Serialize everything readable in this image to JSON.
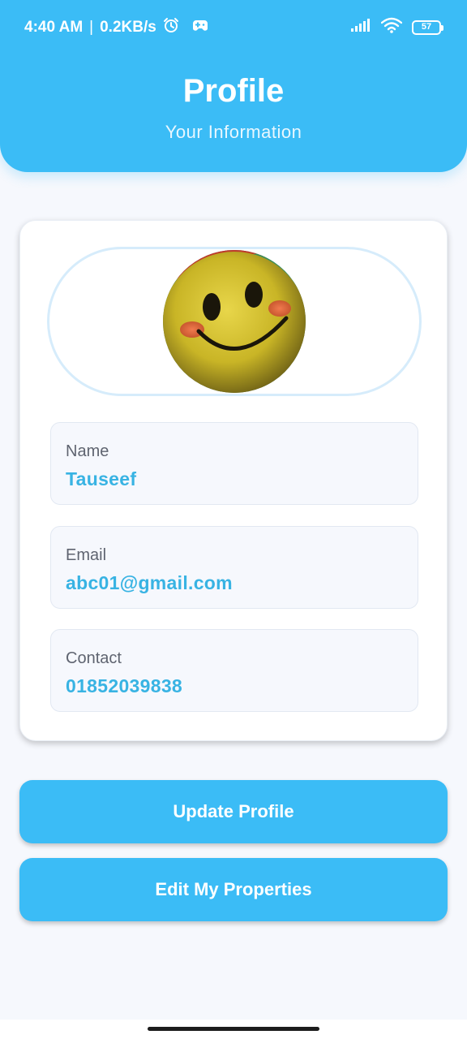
{
  "status_bar": {
    "time": "4:40 AM",
    "separator": "|",
    "network_speed": "0.2KB/s",
    "battery_level": "57",
    "icons": [
      "alarm-icon",
      "gamepad-icon",
      "signal-icon",
      "wifi-icon",
      "battery-icon"
    ]
  },
  "header": {
    "title": "Profile",
    "subtitle": "Your Information"
  },
  "profile": {
    "avatar": "smiley-face-avatar",
    "fields": [
      {
        "label": "Name",
        "value": "Tauseef"
      },
      {
        "label": "Email",
        "value": "abc01@gmail.com"
      },
      {
        "label": "Contact",
        "value": "01852039838"
      }
    ]
  },
  "actions": {
    "update_label": "Update Profile",
    "edit_properties_label": "Edit My Properties"
  },
  "colors": {
    "accent": "#3bbcf6",
    "value_text": "#38b3e3",
    "background": "#f6f8fd"
  }
}
